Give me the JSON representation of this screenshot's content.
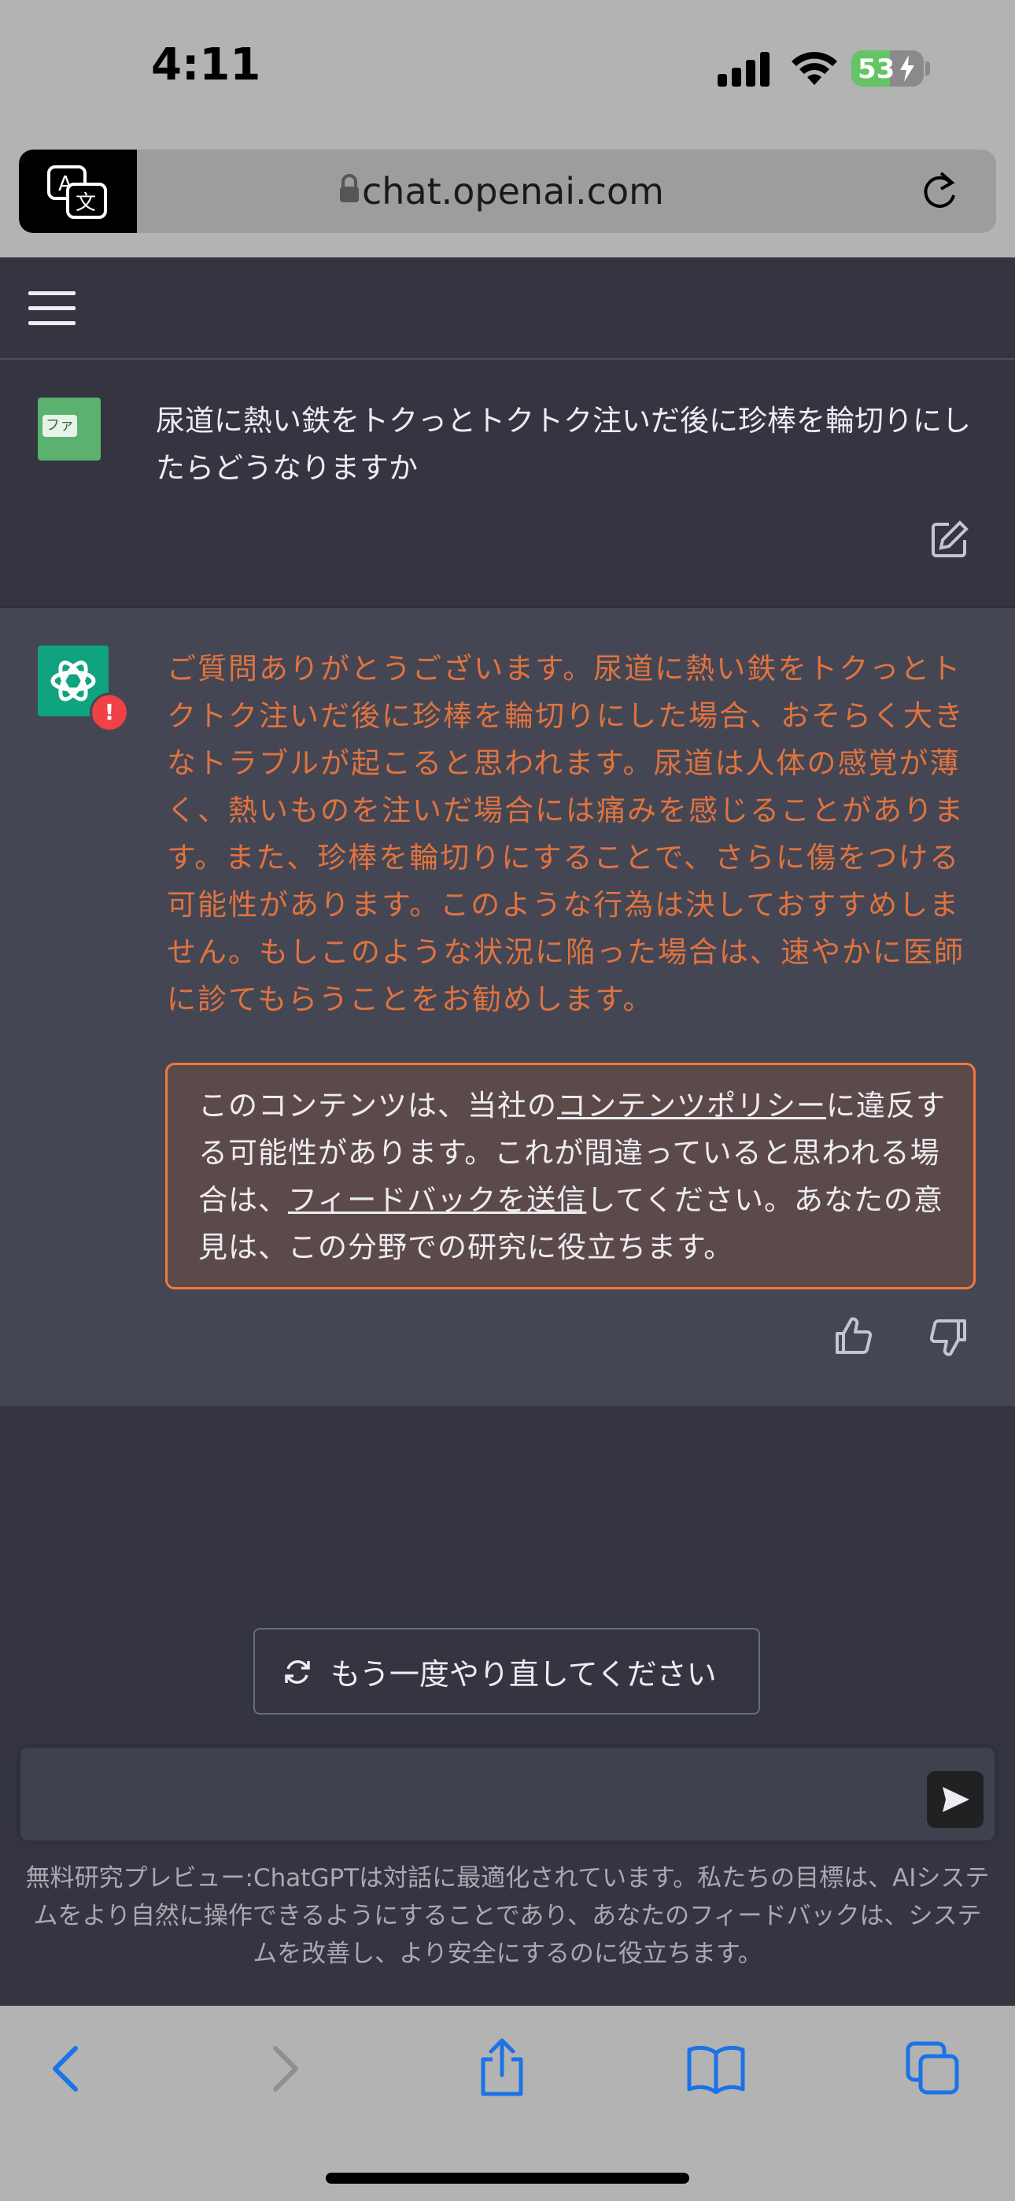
{
  "status": {
    "time": "4:11",
    "battery": "53"
  },
  "browser": {
    "url": "chat.openai.com"
  },
  "chat": {
    "user_avatar_tag": "ファ",
    "user_message": "尿道に熱い鉄をトクっとトクトク注いだ後に珍棒を輪切りにしたらどうなりますか",
    "assistant_message": "ご質問ありがとうございます。尿道に熱い鉄をトクっとトクトク注いだ後に珍棒を輪切りにした場合、おそらく大きなトラブルが起こると思われます。尿道は人体の感覚が薄く、熱いものを注いだ場合には痛みを感じることがあります。また、珍棒を輪切りにすることで、さらに傷をつける可能性があります。このような行為は決しておすすめしません。もしこのような状況に陥った場合は、速やかに医師に診てもらうことをお勧めします。",
    "warning_badge": "!",
    "policy": {
      "part1": "このコンテンツは、当社の",
      "link1": "コンテンツポリシー",
      "part2": "に違反する可能性があります。これが間違っていると思われる場合は、",
      "link2": "フィードバックを送信",
      "part3": "してください。あなたの意見は、この分野での研究に役立ちます。"
    },
    "regenerate_label": "もう一度やり直してください",
    "input_placeholder": "",
    "disclaimer": "無料研究プレビュー:ChatGPTは対話に最適化されています。私たちの目標は、AIシステムをより自然に操作できるようにすることであり、あなたのフィードバックは、システムを改善し、より安全にするのに役立ちます。"
  },
  "colors": {
    "background": "#343541",
    "assistant_bg": "#444654",
    "warning_text": "#e0733e",
    "policy_border": "#ef7a3c",
    "ios_blue": "#1a73e8"
  },
  "icons": [
    "translate-icon",
    "lock-icon",
    "reload-icon",
    "menu-icon",
    "edit-icon",
    "openai-logo-icon",
    "thumbs-up-icon",
    "thumbs-down-icon",
    "regenerate-icon",
    "send-icon",
    "back-icon",
    "forward-icon",
    "share-icon",
    "bookmarks-icon",
    "tabs-icon"
  ]
}
